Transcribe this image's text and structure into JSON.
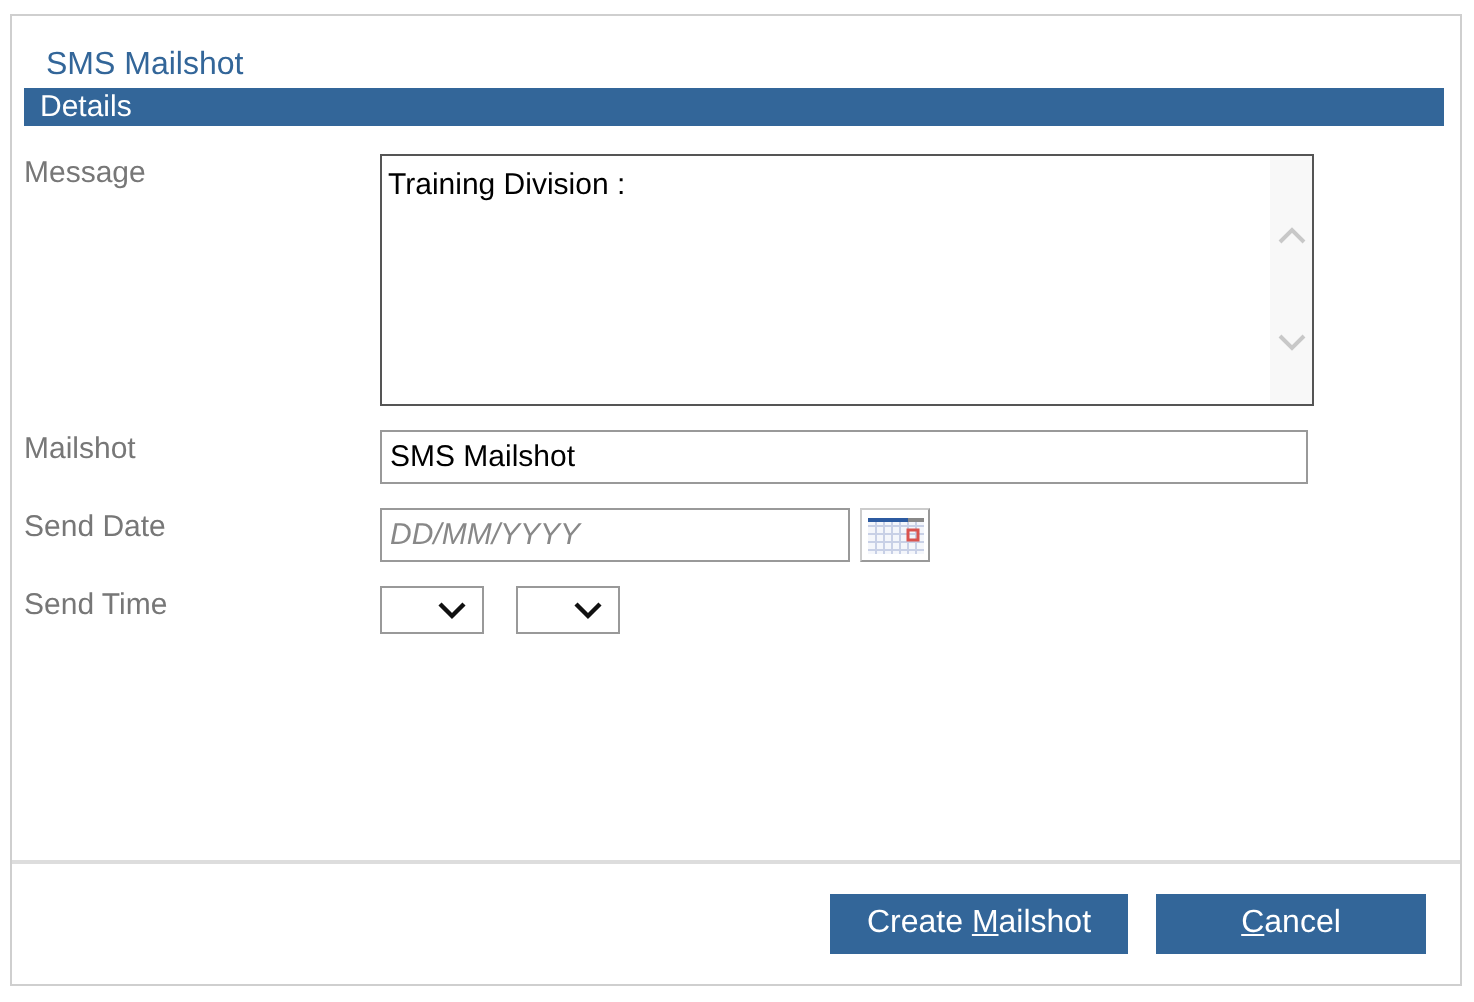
{
  "window": {
    "title": "SMS Mailshot"
  },
  "section": {
    "title": "Details"
  },
  "fields": [
    {
      "kind": "textarea",
      "label": "Message",
      "value": "Training Division :"
    },
    {
      "kind": "text",
      "label": "Mailshot",
      "value": "SMS Mailshot"
    },
    {
      "kind": "date",
      "label": "Send Date",
      "placeholder": "DD/MM/YYYY"
    },
    {
      "kind": "time",
      "label": "Send Time"
    }
  ],
  "buttons": [
    {
      "before": "Create ",
      "key": "M",
      "after": "ailshot"
    },
    {
      "key": "C",
      "after": "ancel"
    }
  ]
}
